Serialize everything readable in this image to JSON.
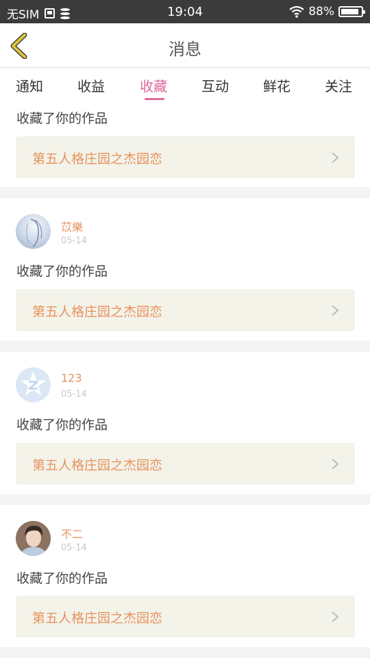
{
  "status_bar": {
    "carrier": "无SIM",
    "time": "19:04",
    "battery": "88%"
  },
  "header": {
    "title": "消息"
  },
  "tabs": [
    {
      "label": "通知"
    },
    {
      "label": "收益"
    },
    {
      "label": "收藏",
      "active": true
    },
    {
      "label": "互动"
    },
    {
      "label": "鲜花"
    },
    {
      "label": "关注"
    }
  ],
  "items": [
    {
      "action": "收藏了你的作品",
      "work_title": "第五人格庄园之杰园恋"
    },
    {
      "user": "苡樂",
      "date": "05-14",
      "action": "收藏了你的作品",
      "work_title": "第五人格庄园之杰园恋"
    },
    {
      "user": "123",
      "date": "05-14",
      "action": "收藏了你的作品",
      "work_title": "第五人格庄园之杰园恋"
    },
    {
      "user": "不二",
      "date": "05-14",
      "action": "收藏了你的作品",
      "work_title": "第五人格庄园之杰园恋"
    }
  ],
  "colors": {
    "accent": "#e0679a",
    "username": "#e8935f",
    "back_icon": "#e2c33a"
  }
}
